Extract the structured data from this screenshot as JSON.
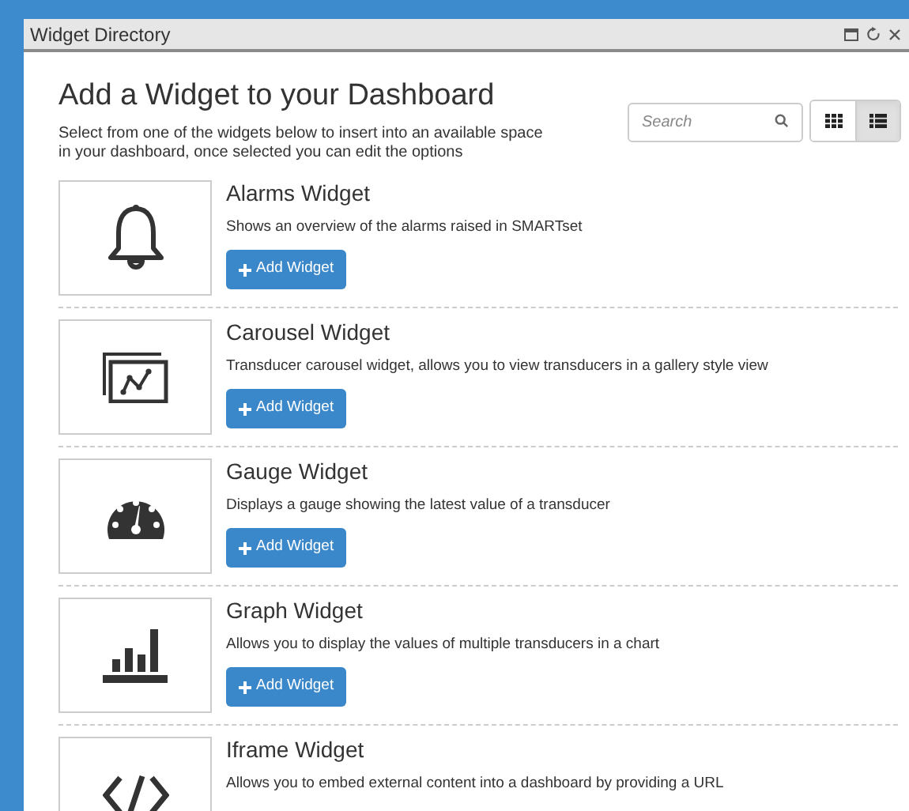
{
  "window": {
    "title": "Widget Directory"
  },
  "header": {
    "title": "Add a Widget to your Dashboard",
    "description": "Select from one of the widgets below to insert into an available space in your dashboard, once selected you can edit the options"
  },
  "search": {
    "placeholder": "Search"
  },
  "view_toggles": [
    {
      "kind": "grid",
      "selected": false
    },
    {
      "kind": "list",
      "selected": true
    }
  ],
  "widgets": [
    {
      "kind": "bell",
      "name": "Alarms Widget",
      "description": "Shows an overview of the alarms raised in SMARTset",
      "button": "Add Widget"
    },
    {
      "kind": "carousel",
      "name": "Carousel Widget",
      "description": "Transducer carousel widget, allows you to view transducers in a gallery style view",
      "button": "Add Widget"
    },
    {
      "kind": "gauge",
      "name": "Gauge Widget",
      "description": "Displays a gauge showing the latest value of a transducer",
      "button": "Add Widget"
    },
    {
      "kind": "chart",
      "name": "Graph Widget",
      "description": "Allows you to display the values of multiple transducers in a chart",
      "button": "Add Widget"
    },
    {
      "kind": "code",
      "name": "Iframe Widget",
      "description": "Allows you to embed external content into a dashboard by providing a URL"
    }
  ]
}
